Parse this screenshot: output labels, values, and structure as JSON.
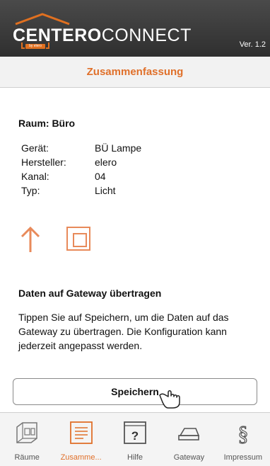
{
  "header": {
    "brand_bold": "CENTERO",
    "brand_light": "CONNECT",
    "byline": "by elero",
    "version": "Ver. 1.2"
  },
  "page": {
    "title": "Zusammenfassung"
  },
  "room": {
    "label": "Raum: Büro"
  },
  "details": [
    {
      "label": "Gerät:",
      "value": "BÜ Lampe"
    },
    {
      "label": "Hersteller:",
      "value": "elero"
    },
    {
      "label": "Kanal:",
      "value": "04"
    },
    {
      "label": "Typ:",
      "value": "Licht"
    }
  ],
  "controls": {
    "up_icon": "arrow-up-icon",
    "stop_icon": "stop-square-icon"
  },
  "transfer": {
    "title": "Daten auf Gateway übertragen",
    "text": "Tippen Sie auf Speichern, um die Daten auf das Gateway zu übertragen. Die Konfiguration kann jederzeit angepasst werden."
  },
  "save_button": {
    "label": "Speichern"
  },
  "tabs": [
    {
      "label": "Räume",
      "icon": "rooms-icon",
      "active": false
    },
    {
      "label": "Zusamme...",
      "icon": "summary-icon",
      "active": true
    },
    {
      "label": "Hilfe",
      "icon": "help-icon",
      "active": false
    },
    {
      "label": "Gateway",
      "icon": "gateway-icon",
      "active": false
    },
    {
      "label": "Impressum",
      "icon": "paragraph-icon",
      "active": false
    }
  ],
  "colors": {
    "accent": "#e0702a",
    "header_bg": "#3a3a3a"
  }
}
